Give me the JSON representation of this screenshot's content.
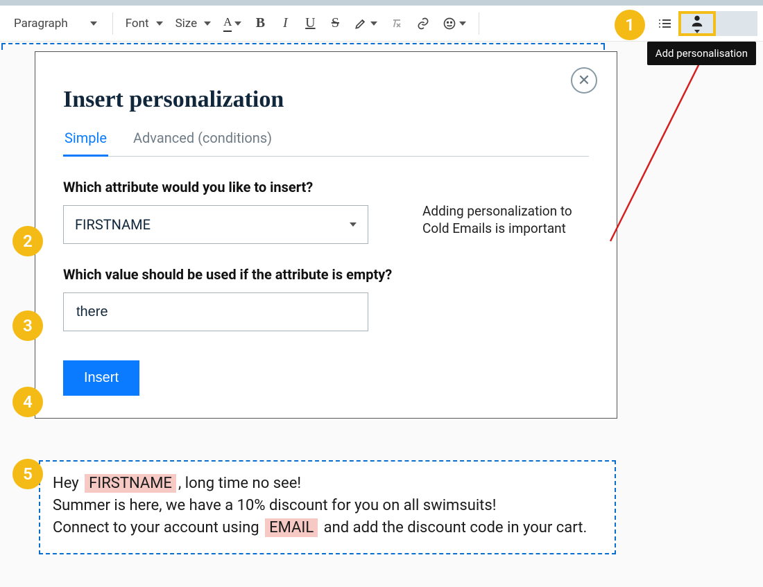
{
  "toolbar": {
    "paragraph_label": "Paragraph",
    "font_label": "Font",
    "size_label": "Size",
    "fontcolor_glyph": "A",
    "bold_glyph": "B",
    "italic_glyph": "I",
    "underline_glyph": "U",
    "strike_glyph": "S",
    "tooltip": "Add personalisation"
  },
  "modal": {
    "title": "Insert personalization",
    "tabs": {
      "simple": "Simple",
      "advanced": "Advanced (conditions)"
    },
    "q_attribute": "Which attribute would you like to insert?",
    "attribute_value": "FIRSTNAME",
    "q_fallback": "Which value should be used if the attribute is empty?",
    "fallback_value": "there",
    "insert_btn": "Insert",
    "side_note": "Adding personalization to Cold Emails is important"
  },
  "editor": {
    "line1_pre": "Hey ",
    "token1": "FIRSTNAME",
    "line1_post": ", long time no see!",
    "line2": "Summer is here, we have a 10% discount for you on all swimsuits!",
    "line3_pre": "Connect to your account using ",
    "token2": "EMAIL",
    "line3_post": " and add the discount code in your cart."
  },
  "markers": {
    "m1": "1",
    "m2": "2",
    "m3": "3",
    "m4": "4",
    "m5": "5"
  }
}
